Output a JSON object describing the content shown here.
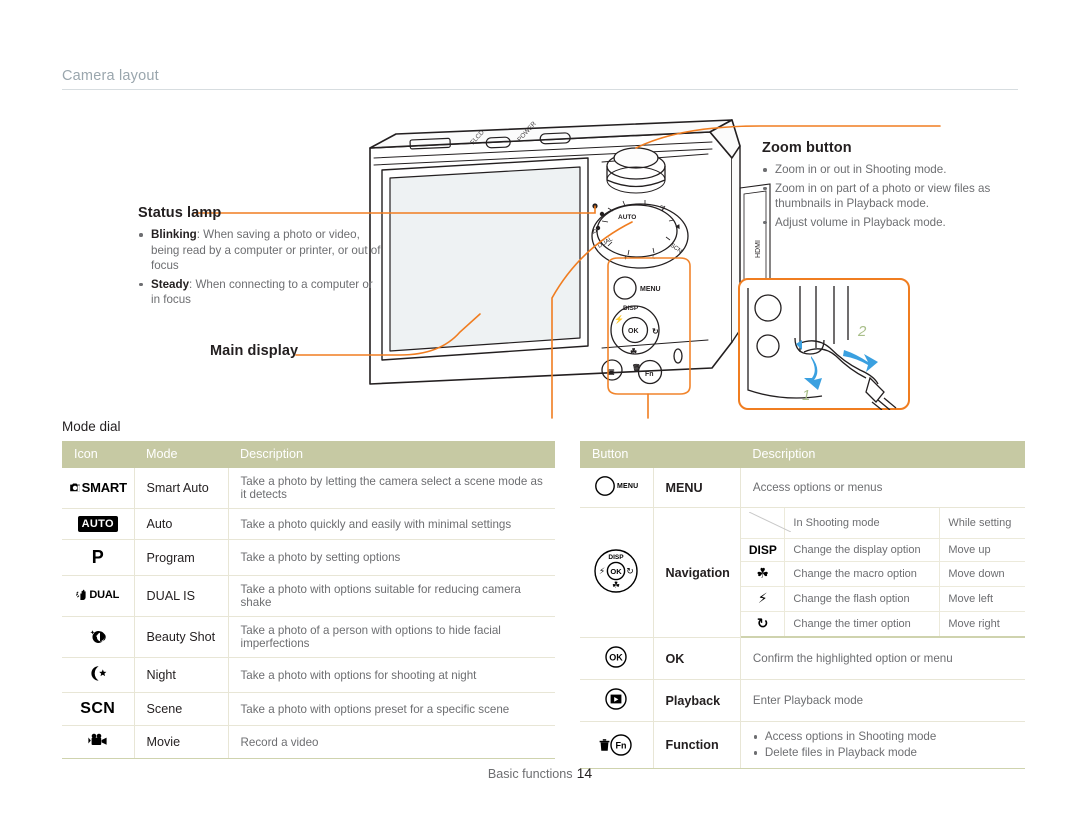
{
  "header": {
    "title": "Camera layout"
  },
  "annotations": {
    "status_lamp": {
      "title": "Status lamp",
      "items": [
        {
          "lead": "Blinking",
          "text": ": When saving a photo or video, being read by a computer or printer, or out of focus"
        },
        {
          "lead": "Steady",
          "text": ": When connecting to a computer or in focus"
        }
      ]
    },
    "zoom_button": {
      "title": "Zoom button",
      "items": [
        {
          "lead": "",
          "text": "Zoom in or out in Shooting mode."
        },
        {
          "lead": "",
          "text": "Zoom in on part of a photo or view files as thumbnails in Playback mode."
        },
        {
          "lead": "",
          "text": "Adjust volume in Playback mode."
        }
      ]
    },
    "main_display": {
      "title": "Main display"
    }
  },
  "illustration": {
    "top_labels": {
      "flcd": "FLCD",
      "power": "POWER"
    },
    "body_labels": {
      "menu": "MENU",
      "disp": "DISP",
      "ok": "OK",
      "fn": "Fn",
      "hdmi": "HDMI"
    },
    "strap_detail": {
      "step1": "1",
      "step2": "2"
    }
  },
  "mode_dial_table": {
    "title": "Mode dial",
    "columns": [
      "Icon",
      "Mode",
      "Description"
    ],
    "rows": [
      {
        "icon": "smart-auto-icon",
        "icon_text": "SMART",
        "mode": "Smart Auto",
        "description": "Take a photo by letting the camera select a scene mode as it detects"
      },
      {
        "icon": "auto-icon",
        "icon_text": "AUTO",
        "mode": "Auto",
        "description": "Take a photo quickly and easily with minimal settings"
      },
      {
        "icon": "program-icon",
        "icon_text": "P",
        "mode": "Program",
        "description": "Take a photo by setting options"
      },
      {
        "icon": "dual-is-icon",
        "icon_text": "DUAL",
        "mode": "DUAL IS",
        "description": "Take a photo with options suitable for reducing camera shake"
      },
      {
        "icon": "beauty-shot-icon",
        "icon_text": "",
        "mode": "Beauty Shot",
        "description": "Take a photo of a person with options to hide facial imperfections"
      },
      {
        "icon": "night-icon",
        "icon_text": "",
        "mode": "Night",
        "description": "Take a photo with options for shooting at night"
      },
      {
        "icon": "scene-icon",
        "icon_text": "SCN",
        "mode": "Scene",
        "description": "Take a photo with options preset for a specific scene"
      },
      {
        "icon": "movie-icon",
        "icon_text": "",
        "mode": "Movie",
        "description": "Record a video"
      }
    ]
  },
  "button_table": {
    "columns": [
      "Button",
      "Description"
    ],
    "rows": [
      {
        "icon": "menu-button-icon",
        "icon_text": "MENU",
        "label": "MENU",
        "description": "Access options or menus"
      },
      {
        "icon": "navigation-button-icon",
        "label": "Navigation",
        "description": ""
      },
      {
        "icon": "ok-button-icon",
        "icon_text": "OK",
        "label": "OK",
        "description": "Confirm the highlighted option or menu"
      },
      {
        "icon": "playback-button-icon",
        "label": "Playback",
        "description": "Enter Playback mode"
      },
      {
        "icon": "function-button-icon",
        "icon_text": "Fn",
        "label": "Function",
        "description": ""
      }
    ],
    "navigation_sub": {
      "columns": [
        "",
        "In Shooting mode",
        "While setting"
      ],
      "rows": [
        {
          "icon": "DISP",
          "icon_name": "disp-icon",
          "shooting": "Change the display option",
          "setting": "Move up"
        },
        {
          "icon": "☘",
          "icon_name": "macro-icon",
          "shooting": "Change the macro option",
          "setting": "Move down"
        },
        {
          "icon": "⚡",
          "icon_name": "flash-icon",
          "shooting": "Change the flash option",
          "setting": "Move left"
        },
        {
          "icon": "↻",
          "icon_name": "timer-icon",
          "shooting": "Change the timer option",
          "setting": "Move right"
        }
      ]
    },
    "function_items": [
      "Access options in Shooting mode",
      "Delete files in Playback mode"
    ]
  },
  "footer": {
    "section": "Basic functions",
    "page": "14"
  },
  "colors": {
    "accent_orange": "#f07d20",
    "table_header": "#c6c9a3",
    "heading_gray": "#9aa6ad",
    "body_text": "#6d6e71",
    "strong_text": "#231f20",
    "arrow_blue": "#3aa0e0",
    "step_green": "#a9bf8a"
  }
}
